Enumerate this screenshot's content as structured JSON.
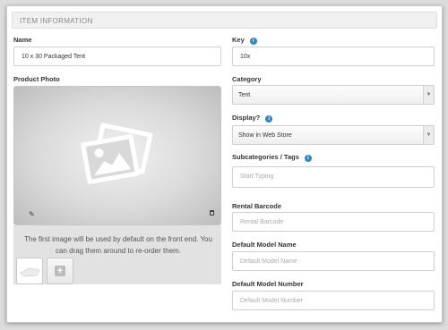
{
  "section": {
    "title": "ITEM INFORMATION"
  },
  "fields": {
    "name": {
      "label": "Name",
      "value": "10 x 30 Packaged Tent"
    },
    "key": {
      "label": "Key",
      "value": "10x"
    },
    "product_photo": {
      "label": "Product Photo"
    },
    "category": {
      "label": "Category",
      "selected": "Tent"
    },
    "display": {
      "label": "Display?",
      "selected": "Show in Web Store"
    },
    "subcategories": {
      "label": "Subcategories / Tags",
      "placeholder": "Start Typing"
    },
    "rental_barcode": {
      "label": "Rental Barcode",
      "placeholder": "Rental Barcode"
    },
    "default_model_name": {
      "label": "Default Model Name",
      "placeholder": "Default Model Name"
    },
    "default_model_number": {
      "label": "Default Model Number",
      "placeholder": "Default Model Number"
    }
  },
  "photo": {
    "caption": "The first image will be used by default on the front end. You can drag them around to re-order them."
  },
  "icons": {
    "info": "info-icon",
    "dropdown": "chevron-down-icon",
    "photo": "image-placeholder-icon",
    "edit": "pencil-icon",
    "delete": "trash-icon",
    "add": "plus-icon"
  },
  "colors": {
    "info_blue": "#2a86d0",
    "header_bg": "#f1f1f1",
    "page_bg": "#dcdcdc"
  }
}
